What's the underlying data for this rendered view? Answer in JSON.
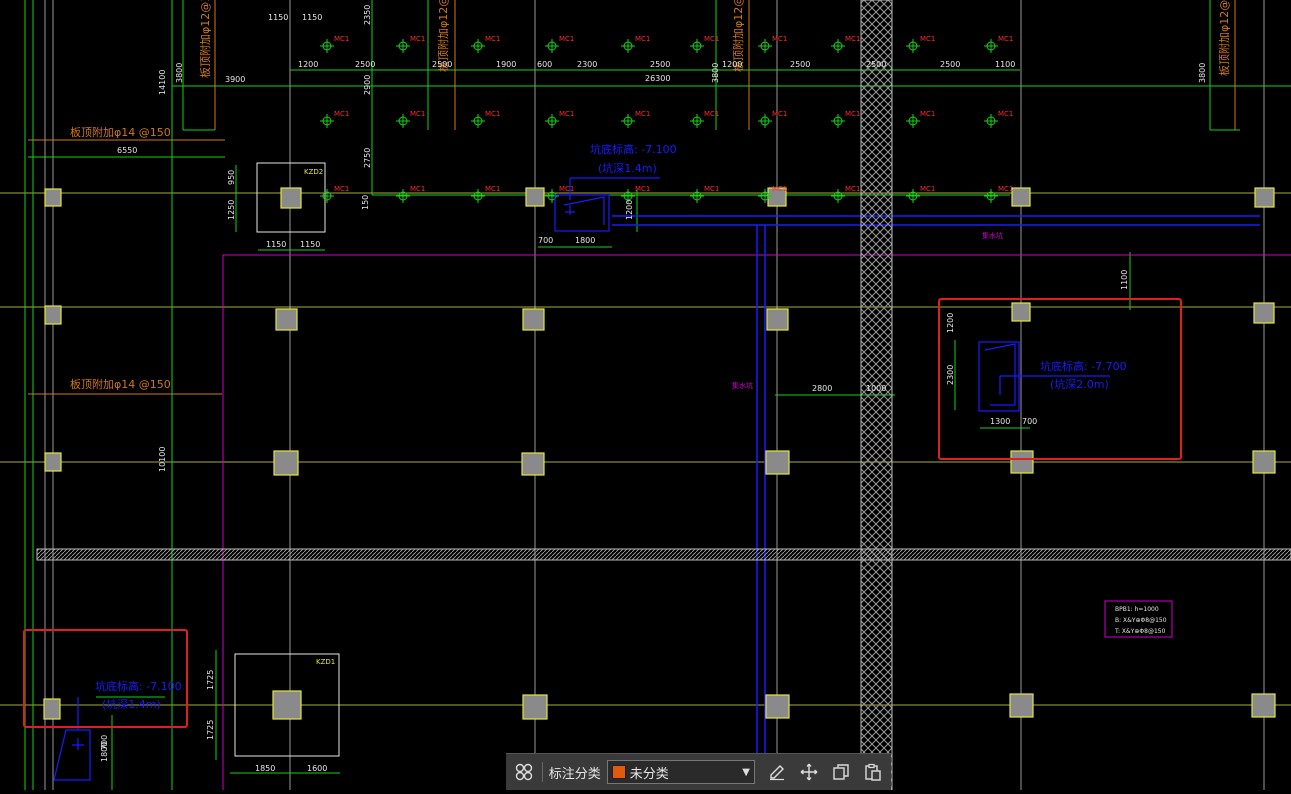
{
  "colors": {
    "grid": "#c8c84a",
    "green": "#18d018",
    "magenta": "#d000d0",
    "blue": "#1a1aff",
    "orange": "#d07818",
    "red_box": "#e02020",
    "white": "#e6e6e6",
    "column_fill": "#8a8a8a"
  },
  "labels": {
    "mc1": "MC1",
    "rebar_top_1": "板顶附加φ12@150",
    "rebar_top_2": "板顶附加φ12@150",
    "rebar_top_3": "板顶附加φ12@150",
    "rebar_left_1": "板顶附加φ14 @150",
    "rebar_left_2": "板顶附加φ14 @150",
    "pit_top_1": "坑底标高: -7.100",
    "pit_top_2": "(坑深1.4m)",
    "pit_right_1": "坑底标高: -7.700",
    "pit_right_2": "(坑深2.0m)",
    "pit_left_1": "坑底标高: -7.100",
    "pit_left_2": "(坑深1.4m)",
    "zone_small": "集水坑",
    "legend_1": "BPB1: h=1000",
    "legend_2": "B: X&Y⊕Φ8@150",
    "legend_3": "T: X&Y⊕Φ8@150",
    "kzd_top": "KZD2",
    "kzd_bottom": "KZD1"
  },
  "dims": {
    "d1150a": "1150",
    "d1150b": "1150",
    "d1150c": "1150",
    "d1150d": "1150",
    "d2350": "2350",
    "d2900": "2900",
    "d2750": "2750",
    "d150": "150",
    "d3800a": "3800",
    "d3800b": "3800",
    "d3800c": "3800",
    "d3900": "3900",
    "d14100": "14100",
    "d6550": "6550",
    "d950": "950",
    "d1250": "1250",
    "d1200a": "1200",
    "d2500a": "2500",
    "d2500b": "2500",
    "d1900": "1900",
    "d600": "600",
    "d2300": "2300",
    "d2500c": "2500",
    "d1200b": "1200",
    "d2500d": "2500",
    "d2500e": "2500",
    "d2500f": "2500",
    "d1100": "1100",
    "d26300": "26300",
    "d700a": "700",
    "d1800a": "1800",
    "d1200c": "1200",
    "d1100b": "1100",
    "d1200d": "1200",
    "d2300b": "2300",
    "d1300": "1300",
    "d700b": "700",
    "d2800": "2800",
    "d1000": "1000",
    "d10100": "10100",
    "d1725a": "1725",
    "d1725b": "1725",
    "d1850": "1850",
    "d1600": "1600",
    "d700c": "700",
    "d1800b": "1800"
  },
  "toolbar": {
    "grid_icon": "grid-icon",
    "category_label": "标注分类",
    "category_value": "未分类",
    "category_color": "#e05a10",
    "edit_icon": "edit-icon",
    "move_icon": "move-icon",
    "copy_icon": "copy-icon",
    "paste_icon": "paste-icon"
  }
}
